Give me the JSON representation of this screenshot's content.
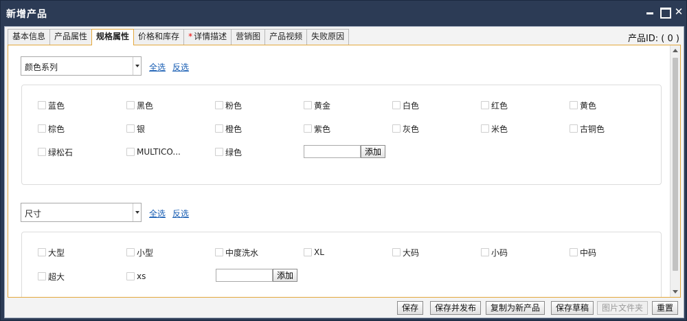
{
  "window": {
    "title": "新增产品"
  },
  "tabs": [
    {
      "label": "基本信息",
      "active": false
    },
    {
      "label": "产品属性",
      "active": false
    },
    {
      "label": "规格属性",
      "active": true
    },
    {
      "label": "价格和库存",
      "active": false
    },
    {
      "label": "详情描述",
      "active": false,
      "required": true,
      "required_mark": "*"
    },
    {
      "label": "营销图",
      "active": false
    },
    {
      "label": "产品视频",
      "active": false
    },
    {
      "label": "失败原因",
      "active": false
    }
  ],
  "product_id": "产品ID: ( 0 )",
  "color_section": {
    "selected": "颜色系列",
    "select_all": "全选",
    "invert": "反选",
    "options": [
      "蓝色",
      "黑色",
      "粉色",
      "黄金",
      "白色",
      "红色",
      "黄色",
      "棕色",
      "银",
      "橙色",
      "紫色",
      "灰色",
      "米色",
      "古铜色",
      "绿松石",
      "MULTICO...",
      "绿色"
    ],
    "add_label": "添加",
    "add_value": ""
  },
  "size_section": {
    "selected": "尺寸",
    "select_all": "全选",
    "invert": "反选",
    "options": [
      "大型",
      "小型",
      "中度洗水",
      "XL",
      "大码",
      "小码",
      "中码",
      "超大",
      "xs"
    ],
    "add_label": "添加",
    "add_value": ""
  },
  "footer": {
    "save": "保存",
    "save_publish": "保存并发布",
    "copy_new": "复制为新产品",
    "save_draft": "保存草稿",
    "image_folder": "图片文件夹",
    "reset": "重置"
  }
}
